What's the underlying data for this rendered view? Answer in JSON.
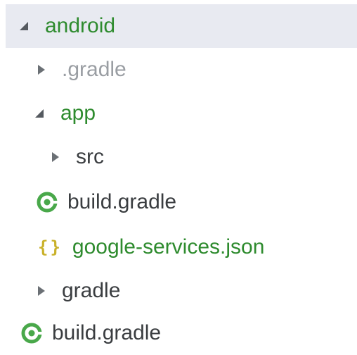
{
  "colors": {
    "folder_text": "#2e8b2e",
    "file_text": "#3a3d40",
    "ignored_text": "#9a9ea3",
    "gradle_icon": "#49a84a",
    "json_icon": "#c9b12a",
    "selected_bg": "#e8eaf1"
  },
  "tree": {
    "items": [
      {
        "label": "android",
        "type": "folder",
        "expanded": true,
        "selected": true,
        "icon": "expanded-arrow-icon"
      },
      {
        "label": ".gradle",
        "type": "folder",
        "expanded": false,
        "ignored": true,
        "icon": "collapsed-arrow-icon"
      },
      {
        "label": "app",
        "type": "folder",
        "expanded": true,
        "icon": "expanded-arrow-icon"
      },
      {
        "label": "src",
        "type": "folder",
        "expanded": false,
        "icon": "collapsed-arrow-icon"
      },
      {
        "label": "build.gradle",
        "type": "file",
        "icon": "gradle-file-icon"
      },
      {
        "label": "google-services.json",
        "type": "file",
        "icon": "json-file-icon"
      },
      {
        "label": "gradle",
        "type": "folder",
        "expanded": false,
        "icon": "collapsed-arrow-icon"
      },
      {
        "label": "build.gradle",
        "type": "file",
        "icon": "gradle-file-icon"
      }
    ]
  }
}
